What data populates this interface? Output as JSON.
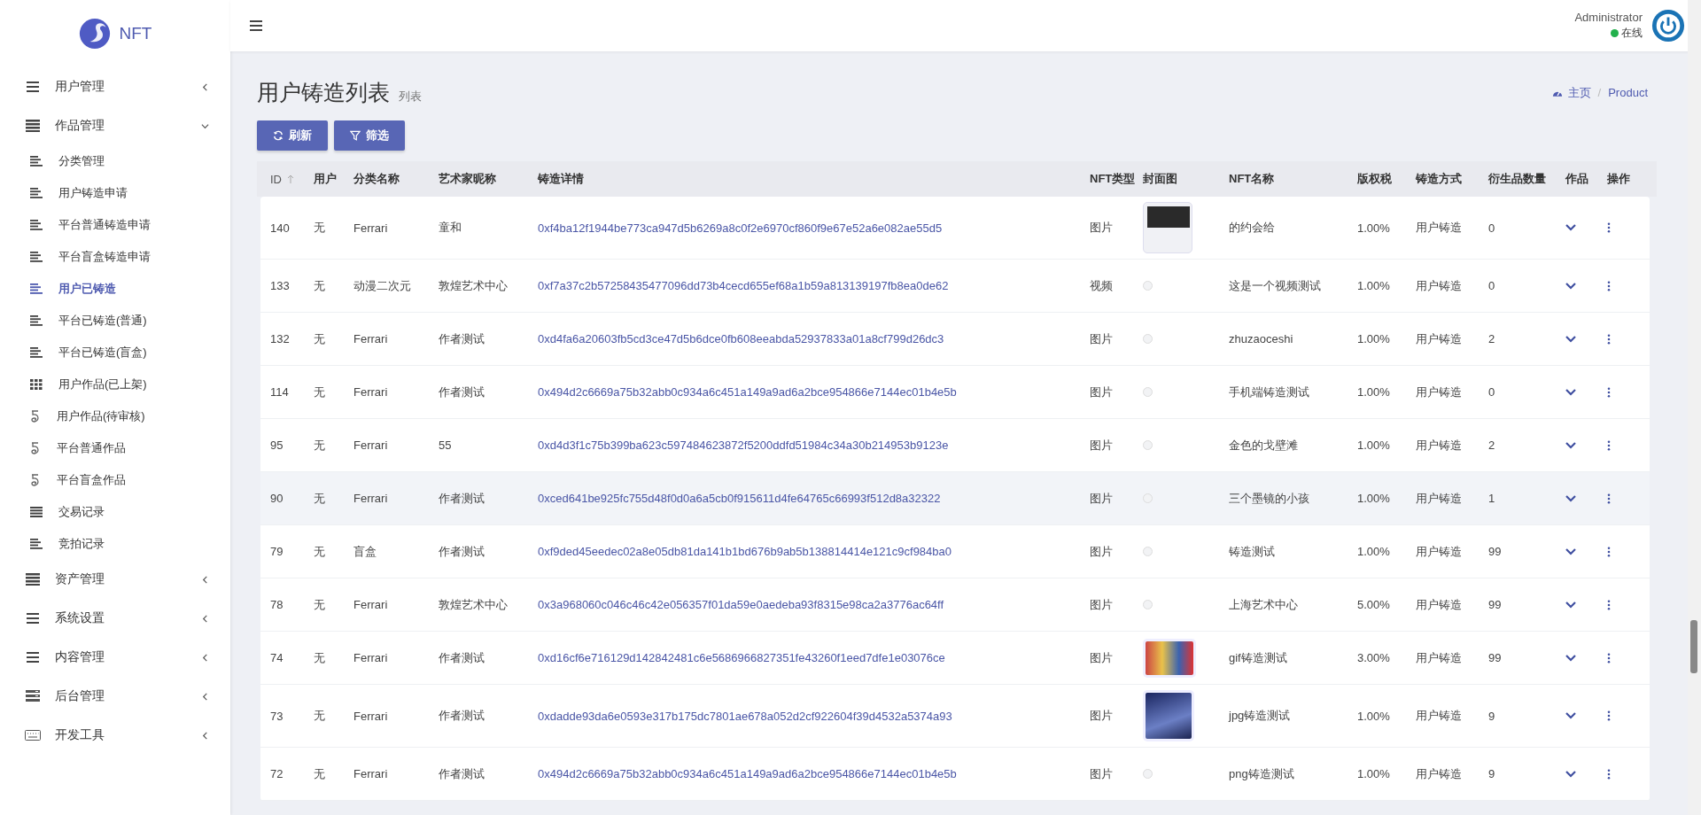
{
  "brand": {
    "name": "NFT"
  },
  "sidebar": {
    "items": [
      {
        "label": "用户管理",
        "expanded": false,
        "selected": false
      },
      {
        "label": "作品管理",
        "expanded": true,
        "selected": false,
        "children": [
          {
            "label": "分类管理",
            "selected": false
          },
          {
            "label": "用户铸造申请",
            "selected": false
          },
          {
            "label": "平台普通铸造申请",
            "selected": false
          },
          {
            "label": "平台盲盒铸造申请",
            "selected": false
          },
          {
            "label": "用户已铸造",
            "selected": true
          },
          {
            "label": "平台已铸造(普通)",
            "selected": false
          },
          {
            "label": "平台已铸造(盲盒)",
            "selected": false
          },
          {
            "label": "用户作品(已上架)",
            "selected": false
          },
          {
            "label": "用户作品(待审核)",
            "selected": false
          },
          {
            "label": "平台普通作品",
            "selected": false
          },
          {
            "label": "平台盲盒作品",
            "selected": false
          },
          {
            "label": "交易记录",
            "selected": false
          },
          {
            "label": "竞拍记录",
            "selected": false
          }
        ]
      },
      {
        "label": "资产管理",
        "expanded": false,
        "selected": false
      },
      {
        "label": "系统设置",
        "expanded": false,
        "selected": false
      },
      {
        "label": "内容管理",
        "expanded": false,
        "selected": false
      },
      {
        "label": "后台管理",
        "expanded": false,
        "selected": false
      },
      {
        "label": "开发工具",
        "expanded": false,
        "selected": false
      }
    ]
  },
  "user": {
    "name": "Administrator",
    "status": "在线",
    "online": true
  },
  "page": {
    "title": "用户铸造列表",
    "subtitle": "列表"
  },
  "breadcrumb": {
    "separator": "/",
    "items": [
      "主页",
      "Product"
    ]
  },
  "buttons": [
    "刷新",
    "筛选"
  ],
  "table": {
    "columns": [
      "ID",
      "用户",
      "分类名称",
      "艺术家昵称",
      "铸造详情",
      "NFT类型",
      "封面图",
      "NFT名称",
      "版权税",
      "铸造方式",
      "衍生品数量",
      "作品",
      "操作"
    ],
    "rows": [
      {
        "id": "140",
        "user": "无",
        "category": "Ferrari",
        "artist": "童和",
        "hash": "0xf4ba12f1944be773ca947d5b6269a8c0f2e6970cf860f9e67e52a6e082ae55d5",
        "type": "图片",
        "cover": {
          "kind": "photo"
        },
        "name": "的约会给",
        "royalty": "1.00%",
        "method": "用户铸造",
        "derivatives": "0",
        "hovered": false
      },
      {
        "id": "133",
        "user": "无",
        "category": "动漫二次元",
        "artist": "敦煌艺术中心",
        "hash": "0xf7a37c2b57258435477096dd73b4cecd655ef68a1b59a813139197fb8ea0de62",
        "type": "视频",
        "cover": {
          "kind": "none"
        },
        "name": "这是一个视频测试",
        "royalty": "1.00%",
        "method": "用户铸造",
        "derivatives": "0",
        "hovered": false
      },
      {
        "id": "132",
        "user": "无",
        "category": "Ferrari",
        "artist": "作者测试",
        "hash": "0xd4fa6a20603fb5cd3ce47d5b6dce0fb608eeabda52937833a01a8cf799d26dc3",
        "type": "图片",
        "cover": {
          "kind": "none"
        },
        "name": "zhuzaoceshi",
        "royalty": "1.00%",
        "method": "用户铸造",
        "derivatives": "2",
        "hovered": false
      },
      {
        "id": "114",
        "user": "无",
        "category": "Ferrari",
        "artist": "作者测试",
        "hash": "0x494d2c6669a75b32abb0c934a6c451a149a9ad6a2bce954866e7144ec01b4e5b",
        "type": "图片",
        "cover": {
          "kind": "none"
        },
        "name": "手机端铸造测试",
        "royalty": "1.00%",
        "method": "用户铸造",
        "derivatives": "0",
        "hovered": false
      },
      {
        "id": "95",
        "user": "无",
        "category": "Ferrari",
        "artist": "55",
        "hash": "0xd4d3f1c75b399ba623c597484623872f5200ddfd51984c34a30b214953b9123e",
        "type": "图片",
        "cover": {
          "kind": "none"
        },
        "name": "金色的戈壁滩",
        "royalty": "1.00%",
        "method": "用户铸造",
        "derivatives": "2",
        "hovered": false
      },
      {
        "id": "90",
        "user": "无",
        "category": "Ferrari",
        "artist": "作者测试",
        "hash": "0xced641be925fc755d48f0d0a6a5cb0f915611d4fe64765c66993f512d8a32322",
        "type": "图片",
        "cover": {
          "kind": "none"
        },
        "name": "三个墨镜的小孩",
        "royalty": "1.00%",
        "method": "用户铸造",
        "derivatives": "1",
        "hovered": true
      },
      {
        "id": "79",
        "user": "无",
        "category": "盲盒",
        "artist": "作者测试",
        "hash": "0xf9ded45eedec02a8e05db81da141b1bd676b9ab5b138814414e121c9cf984ba0",
        "type": "图片",
        "cover": {
          "kind": "none"
        },
        "name": "铸造测试",
        "royalty": "1.00%",
        "method": "用户铸造",
        "derivatives": "99",
        "hovered": false
      },
      {
        "id": "78",
        "user": "无",
        "category": "Ferrari",
        "artist": "敦煌艺术中心",
        "hash": "0x3a968060c046c46c42e056357f01da59e0aedeba93f8315e98ca2a3776ac64ff",
        "type": "图片",
        "cover": {
          "kind": "none"
        },
        "name": "上海艺术中心",
        "royalty": "5.00%",
        "method": "用户铸造",
        "derivatives": "99",
        "hovered": false
      },
      {
        "id": "74",
        "user": "无",
        "category": "Ferrari",
        "artist": "作者测试",
        "hash": "0xd16cf6e716129d142842481c6e5686966827351fe43260f1eed7dfe1e03076ce",
        "type": "图片",
        "cover": {
          "kind": "wide"
        },
        "name": "gif铸造测试",
        "royalty": "3.00%",
        "method": "用户铸造",
        "derivatives": "99",
        "hovered": false
      },
      {
        "id": "73",
        "user": "无",
        "category": "Ferrari",
        "artist": "作者测试",
        "hash": "0xdadde93da6e0593e317b175dc7801ae678a052d2cf922604f39d4532a5374a93",
        "type": "图片",
        "cover": {
          "kind": "square"
        },
        "name": "jpg铸造测试",
        "royalty": "1.00%",
        "method": "用户铸造",
        "derivatives": "9",
        "hovered": false
      },
      {
        "id": "72",
        "user": "无",
        "category": "Ferrari",
        "artist": "作者测试",
        "hash": "0x494d2c6669a75b32abb0c934a6c451a149a9ad6a2bce954866e7144ec01b4e5b",
        "type": "图片",
        "cover": {
          "kind": "none"
        },
        "name": "png铸造测试",
        "royalty": "1.00%",
        "method": "用户铸造",
        "derivatives": "9",
        "hovered": false
      }
    ]
  }
}
